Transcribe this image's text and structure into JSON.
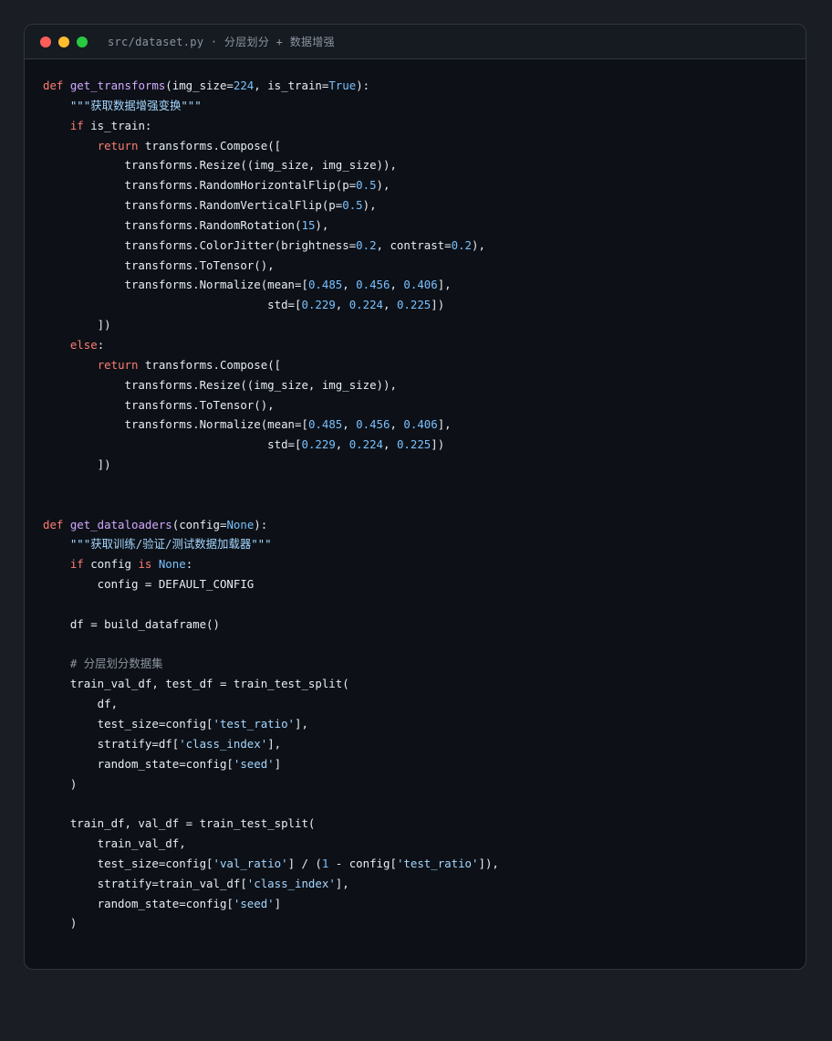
{
  "window": {
    "title": "src/dataset.py · 分层划分 + 数据增强"
  },
  "colors": {
    "background": "#1a1d24",
    "editor": "#0d1117",
    "keyword": "#ff7b72",
    "function": "#d2a8ff",
    "number": "#79c0ff",
    "string": "#a5d6ff",
    "comment": "#8b949e",
    "text": "#e6edf3"
  },
  "code_lines": [
    [
      [
        "kw",
        "def "
      ],
      [
        "fn",
        "get_transforms"
      ],
      [
        "pl",
        "(img_size="
      ],
      [
        "num",
        "224"
      ],
      [
        "pl",
        ", is_train="
      ],
      [
        "num",
        "True"
      ],
      [
        "pl",
        "):"
      ]
    ],
    [
      [
        "pl",
        "    "
      ],
      [
        "str",
        "\"\"\"获取数据增强变换\"\"\""
      ]
    ],
    [
      [
        "pl",
        "    "
      ],
      [
        "kw",
        "if"
      ],
      [
        "pl",
        " is_train:"
      ]
    ],
    [
      [
        "pl",
        "        "
      ],
      [
        "kw",
        "return"
      ],
      [
        "pl",
        " transforms.Compose(["
      ]
    ],
    [
      [
        "pl",
        "            transforms.Resize((img_size, img_size)),"
      ]
    ],
    [
      [
        "pl",
        "            transforms.RandomHorizontalFlip(p="
      ],
      [
        "num",
        "0.5"
      ],
      [
        "pl",
        "),"
      ]
    ],
    [
      [
        "pl",
        "            transforms.RandomVerticalFlip(p="
      ],
      [
        "num",
        "0.5"
      ],
      [
        "pl",
        "),"
      ]
    ],
    [
      [
        "pl",
        "            transforms.RandomRotation("
      ],
      [
        "num",
        "15"
      ],
      [
        "pl",
        "),"
      ]
    ],
    [
      [
        "pl",
        "            transforms.ColorJitter(brightness="
      ],
      [
        "num",
        "0.2"
      ],
      [
        "pl",
        ", contrast="
      ],
      [
        "num",
        "0.2"
      ],
      [
        "pl",
        "),"
      ]
    ],
    [
      [
        "pl",
        "            transforms.ToTensor(),"
      ]
    ],
    [
      [
        "pl",
        "            transforms.Normalize(mean=["
      ],
      [
        "num",
        "0.485"
      ],
      [
        "pl",
        ", "
      ],
      [
        "num",
        "0.456"
      ],
      [
        "pl",
        ", "
      ],
      [
        "num",
        "0.406"
      ],
      [
        "pl",
        "],"
      ]
    ],
    [
      [
        "pl",
        "                                 std=["
      ],
      [
        "num",
        "0.229"
      ],
      [
        "pl",
        ", "
      ],
      [
        "num",
        "0.224"
      ],
      [
        "pl",
        ", "
      ],
      [
        "num",
        "0.225"
      ],
      [
        "pl",
        "])"
      ]
    ],
    [
      [
        "pl",
        "        ])"
      ]
    ],
    [
      [
        "pl",
        "    "
      ],
      [
        "kw",
        "else"
      ],
      [
        "pl",
        ":"
      ]
    ],
    [
      [
        "pl",
        "        "
      ],
      [
        "kw",
        "return"
      ],
      [
        "pl",
        " transforms.Compose(["
      ]
    ],
    [
      [
        "pl",
        "            transforms.Resize((img_size, img_size)),"
      ]
    ],
    [
      [
        "pl",
        "            transforms.ToTensor(),"
      ]
    ],
    [
      [
        "pl",
        "            transforms.Normalize(mean=["
      ],
      [
        "num",
        "0.485"
      ],
      [
        "pl",
        ", "
      ],
      [
        "num",
        "0.456"
      ],
      [
        "pl",
        ", "
      ],
      [
        "num",
        "0.406"
      ],
      [
        "pl",
        "],"
      ]
    ],
    [
      [
        "pl",
        "                                 std=["
      ],
      [
        "num",
        "0.229"
      ],
      [
        "pl",
        ", "
      ],
      [
        "num",
        "0.224"
      ],
      [
        "pl",
        ", "
      ],
      [
        "num",
        "0.225"
      ],
      [
        "pl",
        "])"
      ]
    ],
    [
      [
        "pl",
        "        ])"
      ]
    ],
    [],
    [],
    [
      [
        "kw",
        "def "
      ],
      [
        "fn",
        "get_dataloaders"
      ],
      [
        "pl",
        "(config="
      ],
      [
        "num",
        "None"
      ],
      [
        "pl",
        "):"
      ]
    ],
    [
      [
        "pl",
        "    "
      ],
      [
        "str",
        "\"\"\"获取训练/验证/测试数据加载器\"\"\""
      ]
    ],
    [
      [
        "pl",
        "    "
      ],
      [
        "kw",
        "if"
      ],
      [
        "pl",
        " config "
      ],
      [
        "kw",
        "is"
      ],
      [
        "pl",
        " "
      ],
      [
        "num",
        "None"
      ],
      [
        "pl",
        ":"
      ]
    ],
    [
      [
        "pl",
        "        config = DEFAULT_CONFIG"
      ]
    ],
    [],
    [
      [
        "pl",
        "    df = build_dataframe()"
      ]
    ],
    [],
    [
      [
        "pl",
        "    "
      ],
      [
        "cm",
        "# 分层划分数据集"
      ]
    ],
    [
      [
        "pl",
        "    train_val_df, test_df = train_test_split("
      ]
    ],
    [
      [
        "pl",
        "        df,"
      ]
    ],
    [
      [
        "pl",
        "        test_size=config["
      ],
      [
        "str",
        "'test_ratio'"
      ],
      [
        "pl",
        "],"
      ]
    ],
    [
      [
        "pl",
        "        stratify=df["
      ],
      [
        "str",
        "'class_index'"
      ],
      [
        "pl",
        "],"
      ]
    ],
    [
      [
        "pl",
        "        random_state=config["
      ],
      [
        "str",
        "'seed'"
      ],
      [
        "pl",
        "]"
      ]
    ],
    [
      [
        "pl",
        "    )"
      ]
    ],
    [],
    [
      [
        "pl",
        "    train_df, val_df = train_test_split("
      ]
    ],
    [
      [
        "pl",
        "        train_val_df,"
      ]
    ],
    [
      [
        "pl",
        "        test_size=config["
      ],
      [
        "str",
        "'val_ratio'"
      ],
      [
        "pl",
        "] / ("
      ],
      [
        "num",
        "1"
      ],
      [
        "pl",
        " - config["
      ],
      [
        "str",
        "'test_ratio'"
      ],
      [
        "pl",
        "]),"
      ]
    ],
    [
      [
        "pl",
        "        stratify=train_val_df["
      ],
      [
        "str",
        "'class_index'"
      ],
      [
        "pl",
        "],"
      ]
    ],
    [
      [
        "pl",
        "        random_state=config["
      ],
      [
        "str",
        "'seed'"
      ],
      [
        "pl",
        "]"
      ]
    ],
    [
      [
        "pl",
        "    )"
      ]
    ]
  ]
}
